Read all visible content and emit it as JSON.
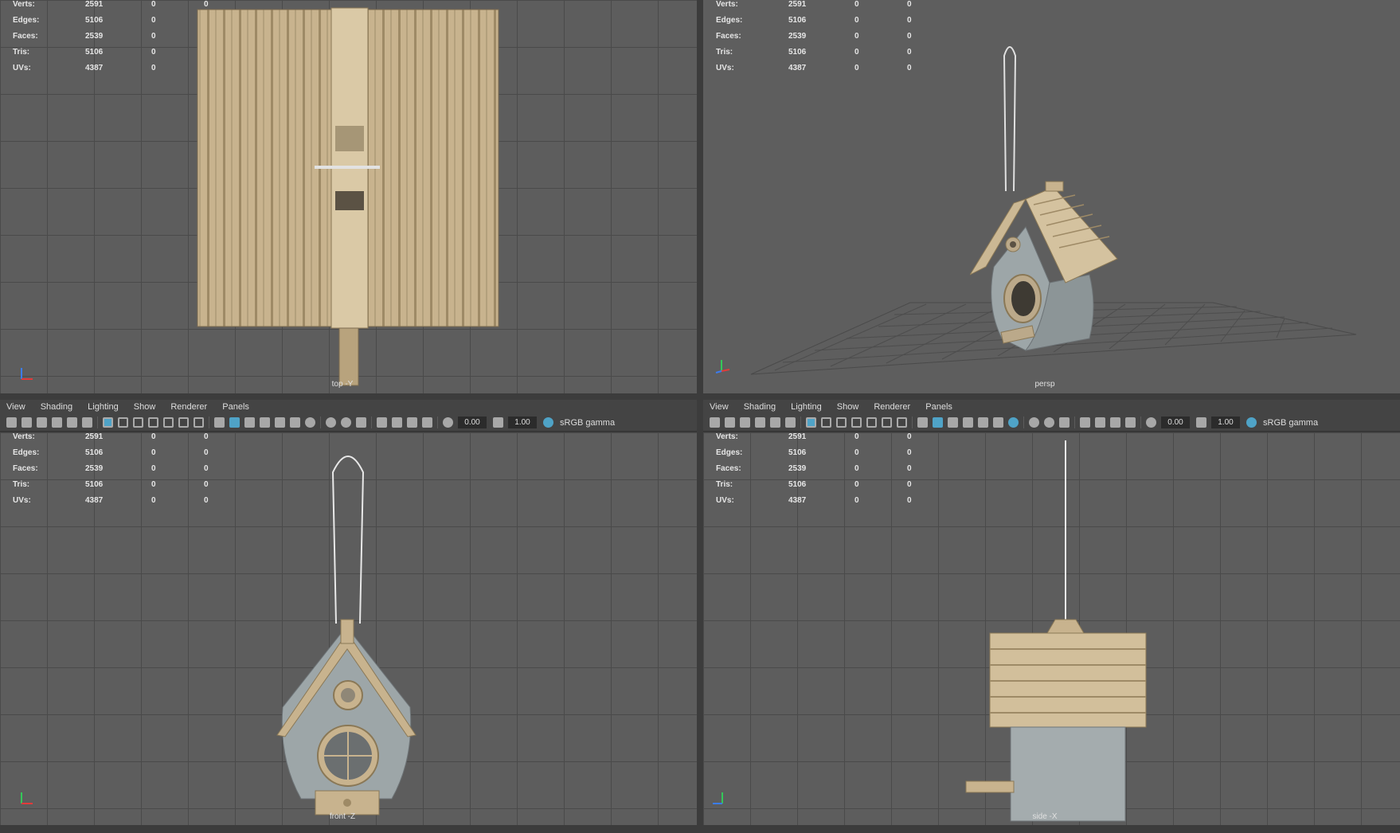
{
  "stats": {
    "rows": [
      {
        "label": "Verts:",
        "v1": "2591",
        "v2": "0",
        "v3": "0"
      },
      {
        "label": "Edges:",
        "v1": "5106",
        "v2": "0",
        "v3": "0"
      },
      {
        "label": "Faces:",
        "v1": "2539",
        "v2": "0",
        "v3": "0"
      },
      {
        "label": "Tris:",
        "v1": "5106",
        "v2": "0",
        "v3": "0"
      },
      {
        "label": "UVs:",
        "v1": "4387",
        "v2": "0",
        "v3": "0"
      }
    ]
  },
  "panels": {
    "top": {
      "camera": "top -Y"
    },
    "persp": {
      "camera": "persp"
    },
    "front": {
      "camera": "front -Z"
    },
    "side": {
      "camera": "side -X"
    }
  },
  "menu": {
    "view": "View",
    "shading": "Shading",
    "lighting": "Lighting",
    "show": "Show",
    "renderer": "Renderer",
    "panels": "Panels"
  },
  "toolbar": {
    "field_a": "0.00",
    "field_b": "1.00",
    "colorspace": "sRGB gamma"
  },
  "colors": {
    "viewport_bg": "#5d5d5d",
    "grid": "#4a4a4a",
    "accent": "#4fa3c7",
    "wood": "#c9b48f",
    "house": "#9aa3a6"
  }
}
